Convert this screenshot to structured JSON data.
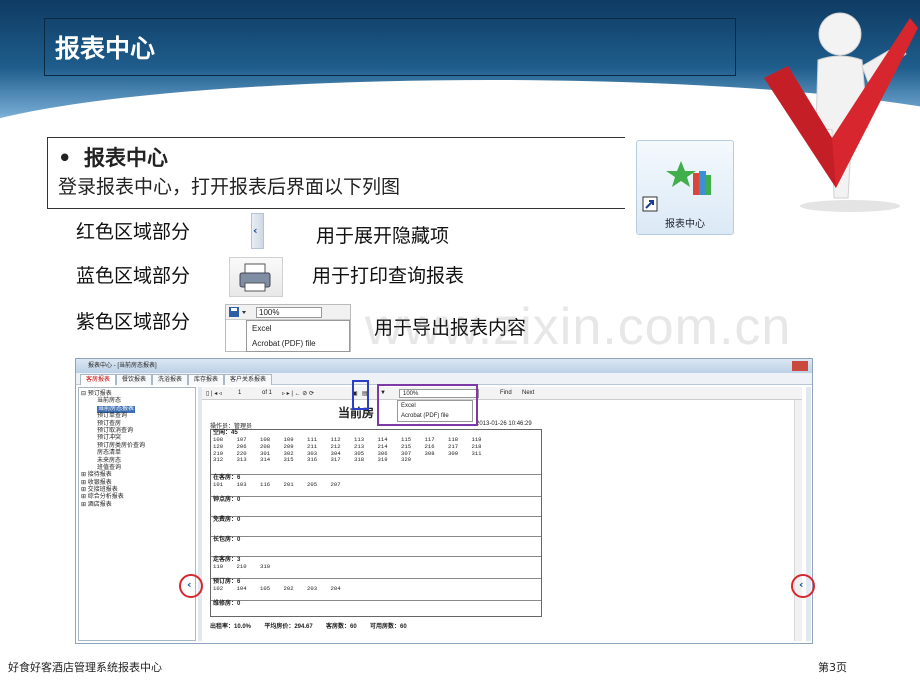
{
  "slide": {
    "title": "报表中心",
    "bullet_heading": "报表中心",
    "bullet_text": "登录报表中心，打开报表后界面以下列图",
    "rows": [
      {
        "label": "红色区域部分",
        "desc": "用于展开隐藏项"
      },
      {
        "label": "蓝色区域部分",
        "desc": "用于打印查询报表"
      },
      {
        "label": "紫色区域部分",
        "desc": "用于导出报表内容"
      }
    ],
    "icon_label": "报表中心",
    "watermark": "www.zixin.com.cn",
    "footer_left": "好食好客酒店管理系统报表中心",
    "footer_right": "第3页",
    "colors": {
      "red": "#d8262e",
      "blue": "#2b3ec8",
      "purple": "#7d3aa7",
      "banner": "#1f5d8c"
    }
  },
  "export_mini": {
    "zoom": "100%",
    "options": [
      "Excel",
      "Acrobat (PDF) file"
    ]
  },
  "window": {
    "title": "报表中心 - [当前房态报表]",
    "tabs": [
      "客房报表",
      "餐饮报表",
      "洗浴报表",
      "库存报表",
      "客户关系报表"
    ],
    "tree": [
      {
        "text": "预订报表",
        "level": 0
      },
      {
        "text": "当前房态",
        "level": 1
      },
      {
        "text": "当前房态报表",
        "level": 1,
        "selected": true
      },
      {
        "text": "预订单查询",
        "level": 1
      },
      {
        "text": "预订查房",
        "level": 1
      },
      {
        "text": "预订取消查询",
        "level": 1
      },
      {
        "text": "预订冲突",
        "level": 1
      },
      {
        "text": "预订房类房价查询",
        "level": 1
      },
      {
        "text": "房态清单",
        "level": 1
      },
      {
        "text": "未来房态",
        "level": 1
      },
      {
        "text": "班值查询",
        "level": 1
      },
      {
        "text": "接待报表",
        "level": 0
      },
      {
        "text": "收银报表",
        "level": 0
      },
      {
        "text": "交接班报表",
        "level": 0
      },
      {
        "text": "综合分析报表",
        "level": 0
      },
      {
        "text": "酒店报表",
        "level": 0
      }
    ],
    "toolbar": {
      "page": "1",
      "of": "of 1",
      "zoom": "100%",
      "find": "Find",
      "next": "Next"
    },
    "menu": [
      "Excel",
      "Acrobat (PDF) file"
    ],
    "report": {
      "title": "当前房",
      "operator": "操作员：管理员",
      "date": "2013-01-26 10:46:29",
      "sections": [
        {
          "head": "空闲：45",
          "rows": [
            "108    107    108    109    111    112    113    114    115    117    118    119",
            "120    206    208    209    211    212    213    214    215    216    217    218",
            "219    220    301    302    303    304    305    306    307    308    309    311",
            "312    313    314    315    316    317    318    319    320"
          ]
        },
        {
          "head": "在客房：6",
          "rows": [
            "101    103    116    201    205    207"
          ]
        },
        {
          "head": "钟点房：0",
          "rows": []
        },
        {
          "head": "免费房：0",
          "rows": []
        },
        {
          "head": "长包房：0",
          "rows": []
        },
        {
          "head": "走客房：3",
          "rows": [
            "110    210    310"
          ]
        },
        {
          "head": "预订房：6",
          "rows": [
            "102    104    105    202    203    204"
          ]
        },
        {
          "head": "维修房：0",
          "rows": []
        }
      ],
      "footer": "出租率：10.0%        平均房价：294.67        客房数：60        可用房数：60"
    }
  }
}
